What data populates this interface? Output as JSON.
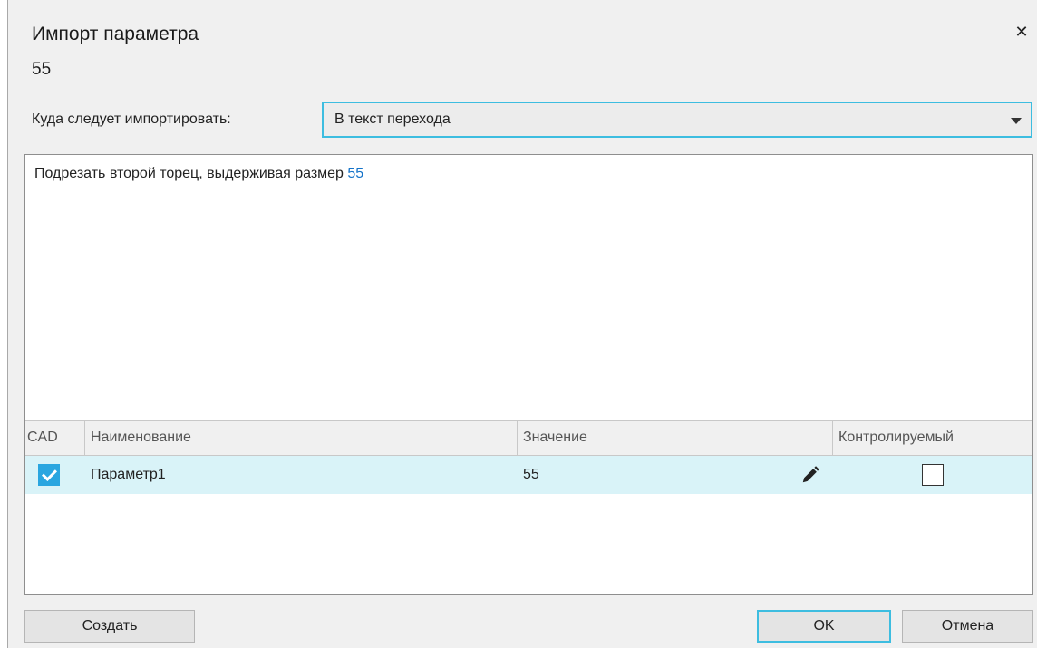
{
  "dialog": {
    "title": "Импорт параметра",
    "close_glyph": "✕",
    "parameter_value": "55"
  },
  "target": {
    "label": "Куда следует импортировать:",
    "selected": "В текст перехода"
  },
  "text_area": {
    "prefix": "Подрезать второй торец, выдерживая размер ",
    "highlight": "55",
    "highlight_color": "#1473c9"
  },
  "grid": {
    "headers": [
      "CAD",
      "Наименование",
      "Значение",
      "Контролируемый"
    ],
    "rows": [
      {
        "cad_checked": true,
        "name": "Параметр1",
        "value": "55",
        "controlled": false
      }
    ]
  },
  "buttons": {
    "create": "Создать",
    "ok": "OK",
    "cancel": "Отмена"
  },
  "colors": {
    "accent": "#3dbde0",
    "row_selected": "#d9f3f8",
    "checkbox": "#2aa6e0"
  },
  "icons": {
    "close": "close-icon",
    "dropdown": "chevron-down-icon",
    "edit": "pencil-icon"
  }
}
